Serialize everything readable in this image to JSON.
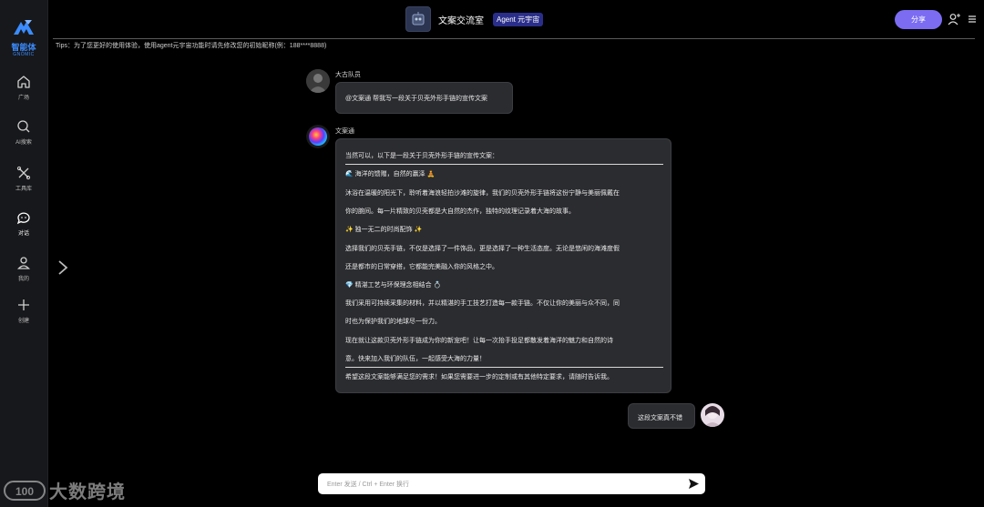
{
  "brand": {
    "name": "智能体",
    "sub": "GNOMIC"
  },
  "nav": [
    {
      "label": "广场"
    },
    {
      "label": "AI搜索"
    },
    {
      "label": "工具库"
    },
    {
      "label": "对话"
    },
    {
      "label": "我的"
    },
    {
      "label": "创建"
    }
  ],
  "header": {
    "title": "文案交流室",
    "badge": "Agent 元宇宙",
    "share_label": "分享"
  },
  "tips": "Tips：为了您更好的使用体验，使用agent元宇宙功能时请先修改您的初始昵称(例：188****8888)",
  "messages": [
    {
      "sender": "大古队员",
      "text": "@文案通 帮我写一段关于贝壳外形手链的宣传文案"
    },
    {
      "sender": "文案通",
      "lines": [
        "当然可以，以下是一段关于贝壳外形手链的宣传文案：",
        "🌊 海洋的馈赠，自然的赢泽 🧘",
        "沐浴在温暖的阳光下，聆听着海浪轻拍沙滩的旋律，我们的贝壳外形手链将这份宁静与美丽佩戴在",
        "你的腕间。每一片精致的贝壳都是大自然的杰作，独特的纹理记录着大海的故事。",
        "✨ 独一无二的时尚配饰 ✨",
        "选择我们的贝壳手链，不仅是选择了一件饰品，更是选择了一种生活态度。无论是悠闲的海滩度假",
        "还是都市的日常穿搭，它都能完美融入你的风格之中。",
        "💎 精湛工艺与环保理念相结合 💍",
        "我们采用可持续采集的材料，并以精湛的手工技艺打造每一款手链。不仅让你的美丽与众不同，同",
        "时也为保护我们的地球尽一份力。",
        "现在就让这款贝壳外形手链成为你的新宠吧！让每一次抬手投足都散发着海洋的魅力和自然的诗",
        "意。快来加入我们的队伍，一起感受大海的力量！",
        "希望这段文案能够满足您的需求！如果您需要进一步的定制或有其他特定要求，请随时告诉我。"
      ]
    },
    {
      "sender": "",
      "text": "这段文案真不错"
    }
  ],
  "input": {
    "placeholder": "Enter 发送 / Ctrl + Enter 换行"
  },
  "watermark": {
    "logo": "100",
    "text": "大数跨境"
  },
  "colors": {
    "accent": "#7b6cf2",
    "brand": "#3b8cff",
    "badge": "#2a2e8a"
  }
}
